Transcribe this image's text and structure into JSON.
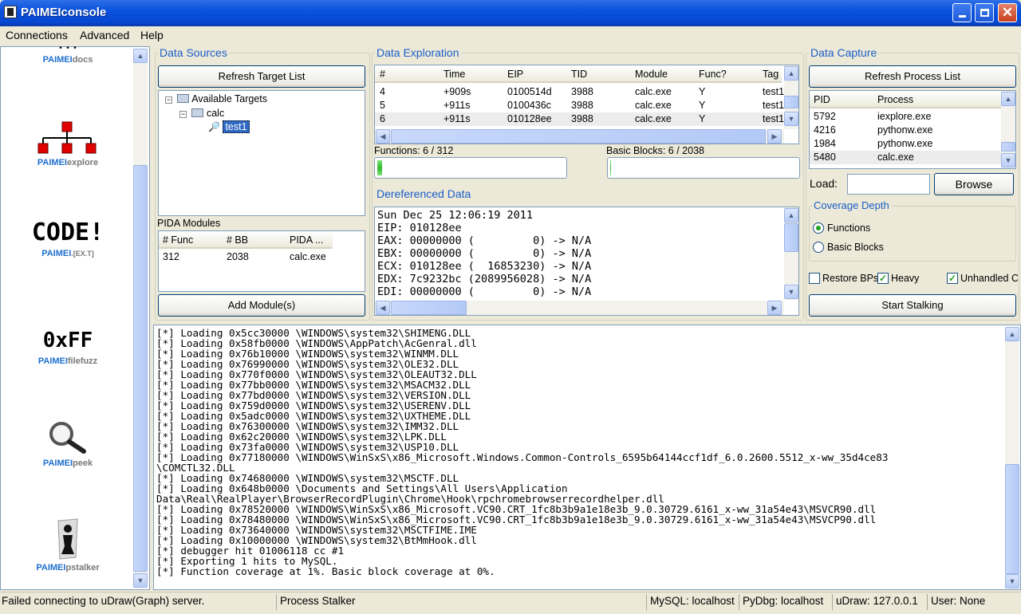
{
  "window": {
    "title": "PAIMEIconsole"
  },
  "menu": [
    "Connections",
    "Advanced",
    "Help"
  ],
  "sidebar": {
    "tools": [
      {
        "name": "PAIMEIdocs",
        "prefix": "PAIMEI",
        "suffix": "docs",
        "icon": "dots-icon"
      },
      {
        "name": "PAIMEIexplore",
        "prefix": "PAIMEI",
        "suffix": "explore",
        "icon": "tree-diagram-icon"
      },
      {
        "name": "PAIMEI.[EX.T]",
        "prefix": "PAIMEI",
        "suffix": ".[EX.T]",
        "icon_text": "CODE!"
      },
      {
        "name": "PAIMEIfilefuzz",
        "prefix": "PAIMEI",
        "suffix": "filefuzz",
        "icon_text": "0xFF"
      },
      {
        "name": "PAIMEIpeek",
        "prefix": "PAIMEI",
        "suffix": "peek",
        "icon": "magnifier-icon"
      },
      {
        "name": "PAIMEIpstalker",
        "prefix": "PAIMEI",
        "suffix": "pstalker",
        "icon": "chess-piece-icon"
      }
    ]
  },
  "data_sources": {
    "title": "Data Sources",
    "refresh_button": "Refresh Target List",
    "tree": {
      "root": "Available Targets",
      "child": "calc",
      "leaf": "test1"
    },
    "pida_label": "PIDA Modules",
    "pida_headers": [
      "# Func",
      "# BB",
      "PIDA ..."
    ],
    "pida_rows": [
      [
        "312",
        "2038",
        "calc.exe"
      ]
    ],
    "add_button": "Add Module(s)"
  },
  "data_exploration": {
    "title": "Data Exploration",
    "headers": [
      "#",
      "Time",
      "EIP",
      "TID",
      "Module",
      "Func?",
      "Tag"
    ],
    "rows": [
      [
        "4",
        "+909s",
        "0100514d",
        "3988",
        "calc.exe",
        "Y",
        "test1"
      ],
      [
        "5",
        "+911s",
        "0100436c",
        "3988",
        "calc.exe",
        "Y",
        "test1"
      ],
      [
        "6",
        "+911s",
        "010128ee",
        "3988",
        "calc.exe",
        "Y",
        "test1"
      ]
    ],
    "functions_label": "Functions: 6 / 312",
    "functions_progress": 0.019,
    "bb_label": "Basic Blocks: 6 / 2038",
    "bb_progress": 0.003
  },
  "dereferenced": {
    "title": "Dereferenced Data",
    "lines": [
      "Sun Dec 25 12:06:19 2011",
      "EIP: 010128ee",
      "EAX: 00000000 (         0) -> N/A",
      "EBX: 00000000 (         0) -> N/A",
      "ECX: 010128ee (  16853230) -> N/A",
      "EDX: 7c9232bc (2089956028) -> N/A",
      "EDI: 00000000 (         0) -> N/A"
    ]
  },
  "data_capture": {
    "title": "Data Capture",
    "refresh_button": "Refresh Process List",
    "headers": [
      "PID",
      "Process"
    ],
    "rows": [
      [
        "5792",
        "iexplore.exe"
      ],
      [
        "4216",
        "pythonw.exe"
      ],
      [
        "1984",
        "pythonw.exe"
      ],
      [
        "5480",
        "calc.exe"
      ]
    ],
    "load_label": "Load:",
    "load_value": "",
    "browse_button": "Browse",
    "coverage_title": "Coverage Depth",
    "opt_functions": "Functions",
    "opt_bb": "Basic Blocks",
    "restore_bps": "Restore BPs",
    "heavy": "Heavy",
    "unhandled": "Unhandled C",
    "start_button": "Start Stalking"
  },
  "log": [
    "[*] Loading 0x5cc30000 \\WINDOWS\\system32\\SHIMENG.DLL",
    "[*] Loading 0x58fb0000 \\WINDOWS\\AppPatch\\AcGenral.dll",
    "[*] Loading 0x76b10000 \\WINDOWS\\system32\\WINMM.DLL",
    "[*] Loading 0x76990000 \\WINDOWS\\system32\\OLE32.DLL",
    "[*] Loading 0x770f0000 \\WINDOWS\\system32\\OLEAUT32.DLL",
    "[*] Loading 0x77bb0000 \\WINDOWS\\system32\\MSACM32.DLL",
    "[*] Loading 0x77bd0000 \\WINDOWS\\system32\\VERSION.DLL",
    "[*] Loading 0x759d0000 \\WINDOWS\\system32\\USERENV.DLL",
    "[*] Loading 0x5adc0000 \\WINDOWS\\system32\\UXTHEME.DLL",
    "[*] Loading 0x76300000 \\WINDOWS\\system32\\IMM32.DLL",
    "[*] Loading 0x62c20000 \\WINDOWS\\system32\\LPK.DLL",
    "[*] Loading 0x73fa0000 \\WINDOWS\\system32\\USP10.DLL",
    "[*] Loading 0x77180000 \\WINDOWS\\WinSxS\\x86_Microsoft.Windows.Common-Controls_6595b64144ccf1df_6.0.2600.5512_x-ww_35d4ce83",
    "\\COMCTL32.DLL",
    "[*] Loading 0x74680000 \\WINDOWS\\system32\\MSCTF.DLL",
    "[*] Loading 0x648b0000 \\Documents and Settings\\All Users\\Application",
    "Data\\Real\\RealPlayer\\BrowserRecordPlugin\\Chrome\\Hook\\rpchromebrowserrecordhelper.dll",
    "[*] Loading 0x78520000 \\WINDOWS\\WinSxS\\x86_Microsoft.VC90.CRT_1fc8b3b9a1e18e3b_9.0.30729.6161_x-ww_31a54e43\\MSVCR90.dll",
    "[*] Loading 0x78480000 \\WINDOWS\\WinSxS\\x86_Microsoft.VC90.CRT_1fc8b3b9a1e18e3b_9.0.30729.6161_x-ww_31a54e43\\MSVCP90.dll",
    "[*] Loading 0x73640000 \\WINDOWS\\system32\\MSCTFIME.IME",
    "[*] Loading 0x10000000 \\WINDOWS\\system32\\BtMmHook.dll",
    "[*] debugger hit 01006118 cc #1",
    "[*] Exporting 1 hits to MySQL.",
    "[*] Function coverage at 1%. Basic block coverage at 0%."
  ],
  "statusbar": {
    "message": "Failed connecting to uDraw(Graph) server.",
    "module": "Process Stalker",
    "mysql": "MySQL: localhost",
    "pydbg": "PyDbg: localhost",
    "udraw": "uDraw: 127.0.0.1",
    "user": "User: None"
  },
  "colors": {
    "accent": "#1c5ec9",
    "title_bar": "#0a52de",
    "progress": "#2fba2b"
  }
}
